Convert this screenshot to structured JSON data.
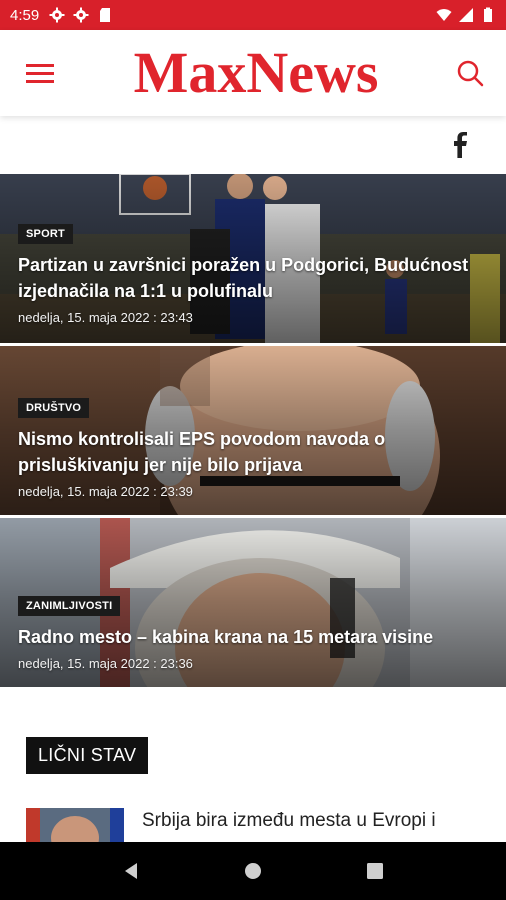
{
  "status_bar": {
    "time": "4:59",
    "icons_left": [
      "gear-icon",
      "gear-icon",
      "sd-card-icon"
    ],
    "icons_right": [
      "wifi-icon",
      "signal-icon",
      "battery-icon"
    ],
    "color": "#d8202a"
  },
  "header": {
    "logo_text": "MaxNews",
    "logo_color": "#e0252d",
    "menu_icon": "hamburger-menu-icon",
    "search_icon": "search-icon"
  },
  "social": {
    "icon": "facebook-icon"
  },
  "articles": [
    {
      "category": "SPORT",
      "title": "Partizan u završnici poražen u Podgorici, Budućnost izjednačila na 1:1 u polufinalu",
      "date": "nedelja, 15. maja 2022 : 23:43"
    },
    {
      "category": "DRUŠTVO",
      "title": "Nismo kontrolisali EPS povodom navoda o prisluškivanju jer nije bilo prijava",
      "date": "nedelja, 15. maja 2022 : 23:39"
    },
    {
      "category": "ZANIMLJIVOSTI",
      "title": "Radno mesto – kabina krana na 15 metara visine",
      "date": "nedelja, 15. maja 2022 : 23:36"
    }
  ],
  "opinion": {
    "section_label": "LIČNI STAV",
    "items": [
      {
        "title": "Srbija bira između mesta u Evropi i"
      }
    ]
  },
  "nav_bar": {
    "back_icon": "back-triangle-icon",
    "home_icon": "home-circle-icon",
    "recents_icon": "recents-square-icon"
  }
}
